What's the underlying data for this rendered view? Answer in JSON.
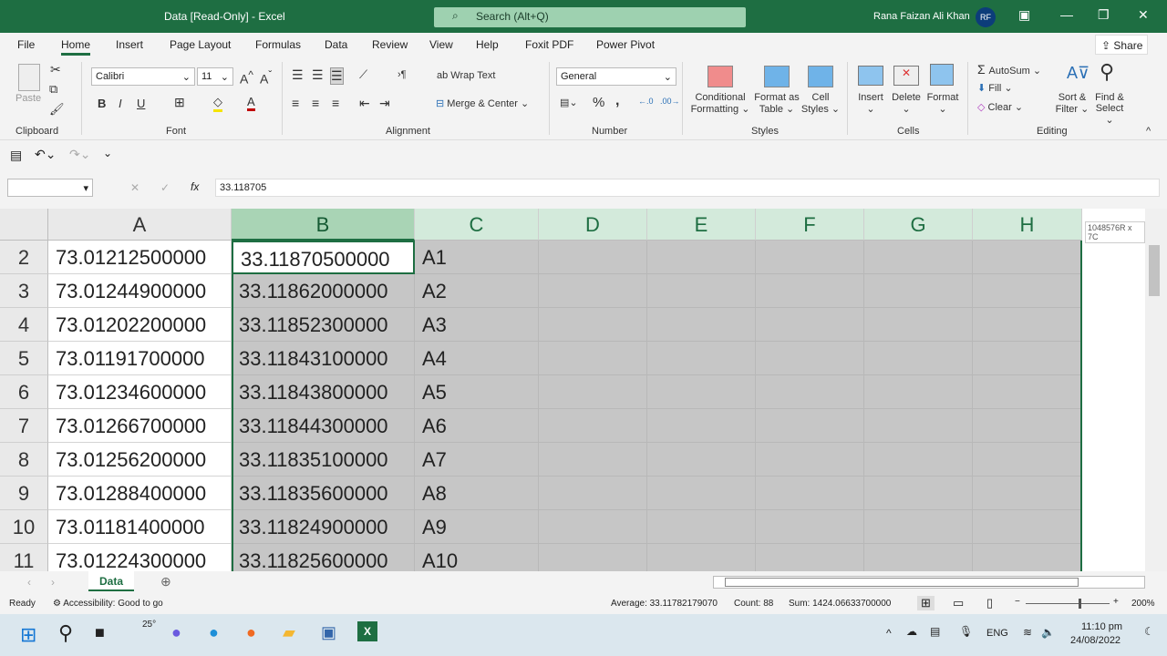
{
  "title": "Data  [Read-Only]  -  Excel",
  "search_placeholder": "Search (Alt+Q)",
  "user": {
    "name": "Rana Faizan Ali Khan",
    "initials": "RF"
  },
  "menu": [
    "File",
    "Home",
    "Insert",
    "Page Layout",
    "Formulas",
    "Data",
    "Review",
    "View",
    "Help",
    "Foxit PDF",
    "Power Pivot"
  ],
  "share": "Share",
  "ribbon": {
    "paste": "Paste",
    "font_name": "Calibri",
    "font_size": "11",
    "wrap_text": "Wrap Text",
    "merge_center": "Merge & Center",
    "number_format": "General",
    "conditional": "Conditional",
    "formatting": "Formatting",
    "format_as": "Format as",
    "table": "Table",
    "cell": "Cell",
    "styles_lbl": "Styles",
    "insert": "Insert",
    "delete": "Delete",
    "format": "Format",
    "autosum": "AutoSum",
    "fill": "Fill",
    "clear": "Clear",
    "sort": "Sort &",
    "filter": "Filter",
    "find": "Find &",
    "select": "Select",
    "groups": [
      "Clipboard",
      "Font",
      "Alignment",
      "Number",
      "Styles",
      "Cells",
      "Editing"
    ]
  },
  "formula_bar": {
    "name_box": "",
    "formula": "33.118705"
  },
  "columns": [
    "A",
    "B",
    "C",
    "D",
    "E",
    "F",
    "G",
    "H"
  ],
  "tooltip": "1048576R x 7C",
  "rows": [
    {
      "n": "2",
      "a": "73.01212500000",
      "b": "33.11870500000",
      "c": "A1"
    },
    {
      "n": "3",
      "a": "73.01244900000",
      "b": "33.11862000000",
      "c": "A2"
    },
    {
      "n": "4",
      "a": "73.01202200000",
      "b": "33.11852300000",
      "c": "A3"
    },
    {
      "n": "5",
      "a": "73.01191700000",
      "b": "33.11843100000",
      "c": "A4"
    },
    {
      "n": "6",
      "a": "73.01234600000",
      "b": "33.11843800000",
      "c": "A5"
    },
    {
      "n": "7",
      "a": "73.01266700000",
      "b": "33.11844300000",
      "c": "A6"
    },
    {
      "n": "8",
      "a": "73.01256200000",
      "b": "33.11835100000",
      "c": "A7"
    },
    {
      "n": "9",
      "a": "73.01288400000",
      "b": "33.11835600000",
      "c": "A8"
    },
    {
      "n": "10",
      "a": "73.01181400000",
      "b": "33.11824900000",
      "c": "A9"
    },
    {
      "n": "11",
      "a": "73.01224300000",
      "b": "33.11825600000",
      "c": "A10"
    }
  ],
  "sheet_tab": "Data",
  "status": {
    "ready": "Ready",
    "accessibility": "Accessibility: Good to go",
    "average": "Average: 33.11782179070",
    "count": "Count: 88",
    "sum": "Sum: 1424.06633700000",
    "zoom": "200%"
  },
  "taskbar": {
    "weather": "25°",
    "lang": "ENG",
    "time": "11:10 pm",
    "date": "24/08/2022"
  },
  "colors": {
    "accent": "#1e6e42",
    "selection": "#c6c6c6"
  }
}
